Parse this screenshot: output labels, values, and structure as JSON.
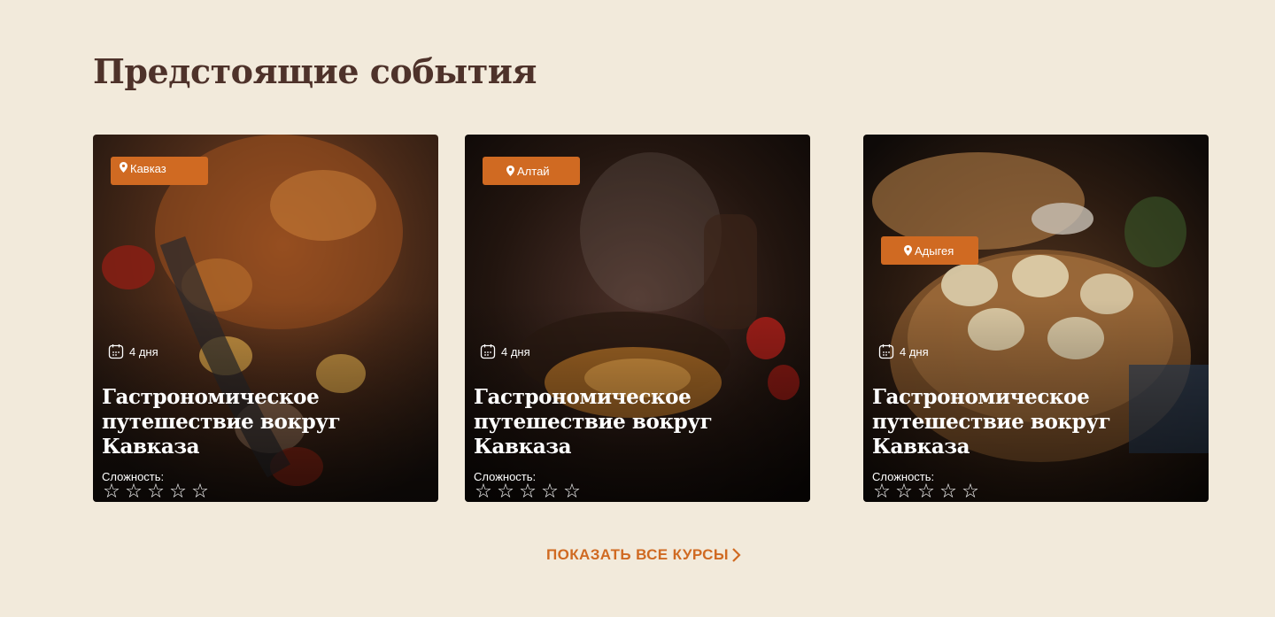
{
  "section": {
    "title": "Предстоящие события"
  },
  "cards": [
    {
      "location": "Кавказ",
      "duration": "4 дня",
      "title": "Гастрономическое путешествие вокруг Кавказа",
      "difficulty_label": "Сложность:",
      "rating": 0,
      "rating_max": 5,
      "image_icon": "grilled-meat-image"
    },
    {
      "location": "Алтай",
      "duration": "4 дня",
      "title": "Гастрономическое путешествие вокруг Кавказа",
      "difficulty_label": "Сложность:",
      "rating": 0,
      "rating_max": 5,
      "image_icon": "plov-image"
    },
    {
      "location": "Адыгея",
      "duration": "4 дня",
      "title": "Гастрономическое путешествие вокруг Кавказа",
      "difficulty_label": "Сложность:",
      "rating": 0,
      "rating_max": 5,
      "image_icon": "dumplings-image"
    }
  ],
  "show_all": {
    "label": "ПОКАЗАТЬ ВСЕ КУРСЫ"
  },
  "colors": {
    "background": "#f2eadb",
    "title": "#4e322a",
    "accent": "#d06a22"
  }
}
